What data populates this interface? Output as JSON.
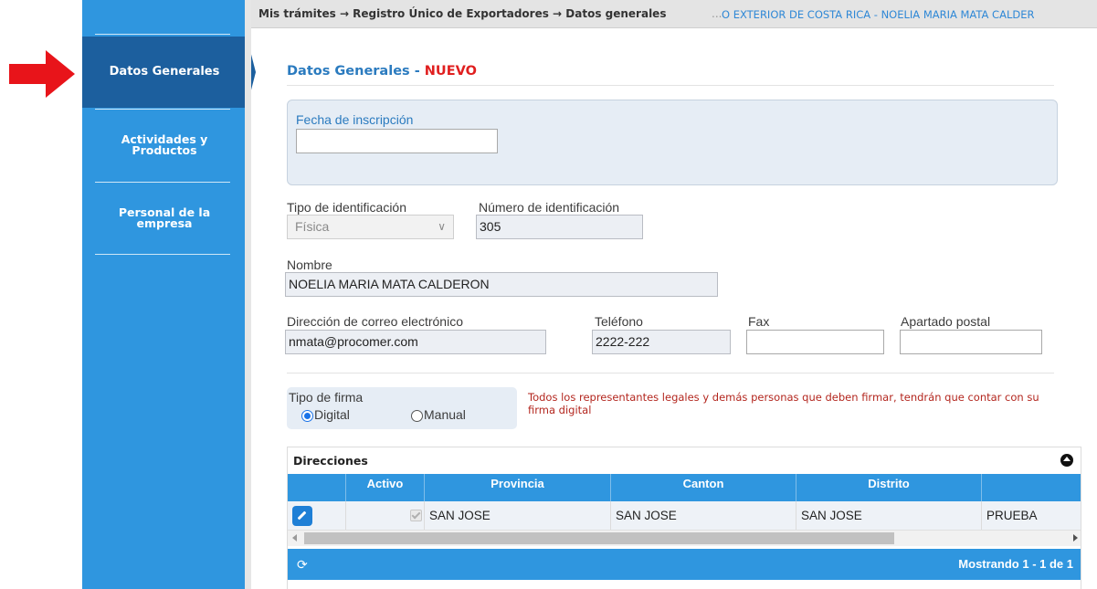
{
  "breadcrumb": {
    "path": "Mis trámites → Registro Único de Exportadores → Datos generales",
    "ellipsis": "...",
    "entity": "O EXTERIOR DE COSTA RICA - NOELIA MARIA MATA CALDER"
  },
  "sidebar": {
    "items": [
      {
        "label": "Datos Generales",
        "active": true
      },
      {
        "label_line1": "Actividades y",
        "label_line2": "Productos"
      },
      {
        "label_line1": "Personal de la",
        "label_line2": "empresa"
      }
    ]
  },
  "page": {
    "title": "Datos Generales - ",
    "badge": "NUEVO"
  },
  "form": {
    "fecha_label": "Fecha de inscripción",
    "fecha_value": "",
    "tipo_id_label": "Tipo de identificación",
    "tipo_id_value": "Física",
    "num_id_label": "Número de identificación",
    "num_id_value": "305",
    "nombre_label": "Nombre",
    "nombre_value": "NOELIA MARIA MATA CALDERON",
    "email_label": "Dirección de correo electrónico",
    "email_value": "nmata@procomer.com",
    "telefono_label": "Teléfono",
    "telefono_value": "2222-222",
    "fax_label": "Fax",
    "fax_value": "",
    "apartado_label": "Apartado postal",
    "apartado_value": "",
    "firma_label": "Tipo de firma",
    "firma_options": [
      "Digital",
      "Manual"
    ],
    "firma_selected": "Digital",
    "firma_note": "Todos los representantes legales y demás personas que deben firmar, tendrán que contar con su firma digital"
  },
  "grid": {
    "caption": "Direcciones",
    "columns": [
      "",
      "Activo",
      "Provincia",
      "Canton",
      "Distrito",
      ""
    ],
    "rows": [
      {
        "activo": true,
        "provincia": "SAN JOSE",
        "canton": "SAN JOSE",
        "distrito": "SAN JOSE",
        "extra": "PRUEBA"
      }
    ],
    "footer": "Mostrando 1 - 1 de 1"
  },
  "colors": {
    "accent": "#2f96df",
    "active": "#1c5f9e",
    "new": "#e01f1f",
    "note": "#b3261e"
  },
  "icons": [
    "arrow-right-icon",
    "chevron-down-icon",
    "edit-icon",
    "collapse-icon",
    "refresh-icon"
  ]
}
